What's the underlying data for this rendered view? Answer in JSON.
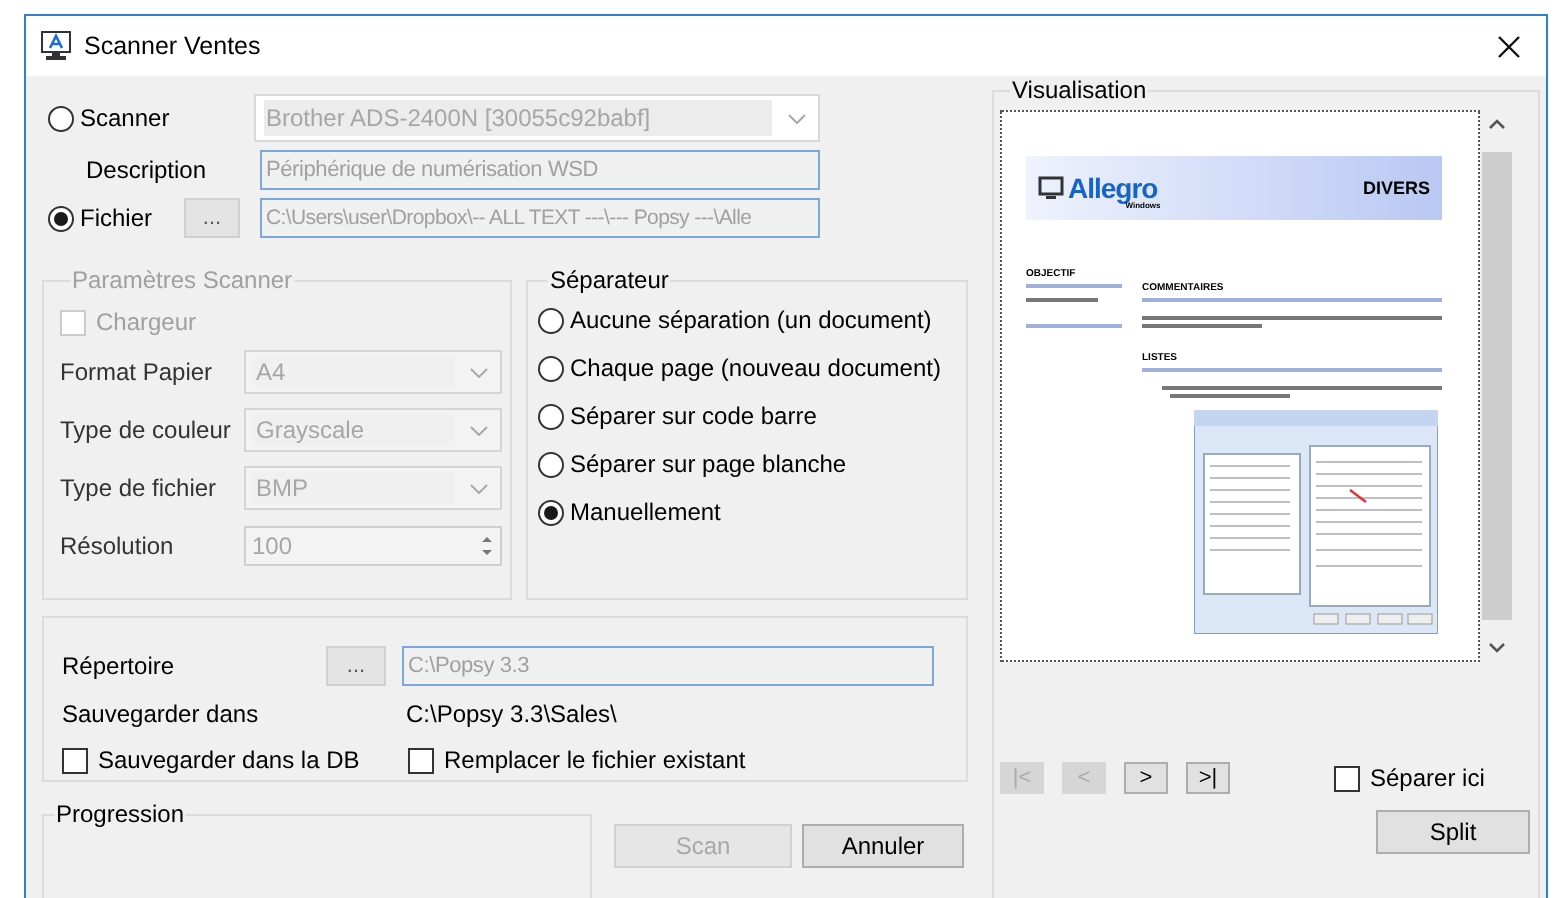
{
  "window": {
    "title": "Scanner Ventes"
  },
  "scanner": {
    "label": "Scanner",
    "selected": false,
    "value": "Brother ADS-2400N [30055c92babf]"
  },
  "description": {
    "label": "Description",
    "value": "Périphérique de numérisation WSD"
  },
  "file": {
    "label": "Fichier",
    "selected": true,
    "browse": "...",
    "value": "C:\\Users\\user\\Dropbox\\-- ALL TEXT ---\\--- Popsy ---\\Alle"
  },
  "scanner_params": {
    "title": "Paramètres Scanner",
    "disabled": true,
    "feeder": {
      "label": "Chargeur",
      "checked": false
    },
    "fields": [
      {
        "label": "Format Papier",
        "kind": "combo",
        "value": "A4"
      },
      {
        "label": "Type de couleur",
        "kind": "combo",
        "value": "Grayscale"
      },
      {
        "label": "Type de fichier",
        "kind": "combo",
        "value": "BMP"
      },
      {
        "label": "Résolution",
        "kind": "spin",
        "value": "100"
      }
    ]
  },
  "separator": {
    "title": "Séparateur",
    "options": [
      {
        "label": "Aucune séparation (un document)",
        "selected": false
      },
      {
        "label": "Chaque page (nouveau document)",
        "selected": false
      },
      {
        "label": "Séparer sur code barre",
        "selected": false
      },
      {
        "label": "Séparer sur page blanche",
        "selected": false
      },
      {
        "label": "Manuellement",
        "selected": true
      }
    ]
  },
  "output": {
    "directory": {
      "label": "Répertoire",
      "browse": "...",
      "value": "C:\\Popsy 3.3"
    },
    "save_in": {
      "label": "Sauvegarder dans",
      "value": "C:\\Popsy 3.3\\Sales\\"
    },
    "options": [
      {
        "label": "Sauvegarder dans la DB",
        "checked": false
      },
      {
        "label": "Remplacer le fichier existant",
        "checked": false
      }
    ]
  },
  "progress": {
    "title": "Progression"
  },
  "actions": [
    {
      "label": "Scan",
      "disabled": true
    },
    {
      "label": "Annuler",
      "disabled": false
    }
  ],
  "preview": {
    "title": "Visualisation",
    "document": {
      "logo": "Allegro",
      "logo_sub": "Windows",
      "heading": "DIVERS",
      "side_title": "OBJECTIF",
      "sections": [
        "COMMENTAIRES",
        "LISTES"
      ]
    },
    "nav": [
      {
        "label": "|<",
        "disabled": true
      },
      {
        "label": "<",
        "disabled": true
      },
      {
        "label": ">",
        "disabled": false
      },
      {
        "label": ">|",
        "disabled": false
      }
    ],
    "split_here": {
      "label": "Séparer ici",
      "checked": false
    },
    "split_button": "Split"
  }
}
